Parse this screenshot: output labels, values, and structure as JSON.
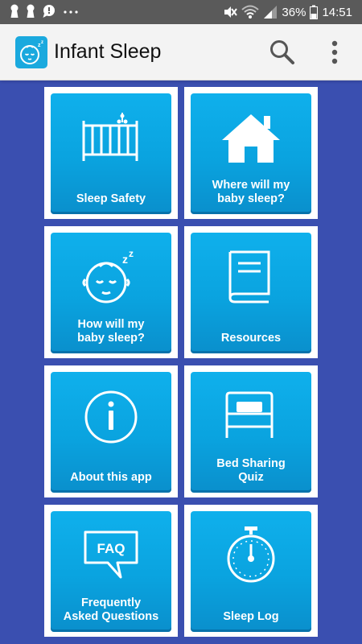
{
  "status_bar": {
    "battery_percent": "36%",
    "time": "14:51",
    "notification_icons": [
      "keyhole-icon",
      "keyhole-icon",
      "chat-bubble-icon",
      "more-dots-icon"
    ],
    "system_icons": [
      "mute-icon",
      "wifi-icon",
      "signal-icon",
      "battery-icon"
    ]
  },
  "app_bar": {
    "title": "Infant Sleep",
    "logo_icon": "sleeping-baby-icon",
    "search_icon": "search-icon",
    "menu_icon": "more-vert-icon"
  },
  "colors": {
    "background": "#3a4fb0",
    "tile": "#0fb0ec",
    "tile_border": "#ffffff",
    "app_bar": "#f3f3f3",
    "status_bar": "#5a5a5a"
  },
  "tiles": [
    {
      "label": "Sleep Safety",
      "icon": "crib-icon"
    },
    {
      "label": "Where will my\nbaby sleep?",
      "icon": "house-icon"
    },
    {
      "label": "How will my\nbaby sleep?",
      "icon": "sleeping-baby-icon"
    },
    {
      "label": "Resources",
      "icon": "book-icon"
    },
    {
      "label": "About this app",
      "icon": "info-icon"
    },
    {
      "label": "Bed Sharing\nQuiz",
      "icon": "bed-icon"
    },
    {
      "label": "Frequently\nAsked Questions",
      "icon": "faq-icon"
    },
    {
      "label": "Sleep Log",
      "icon": "stopwatch-icon"
    }
  ]
}
